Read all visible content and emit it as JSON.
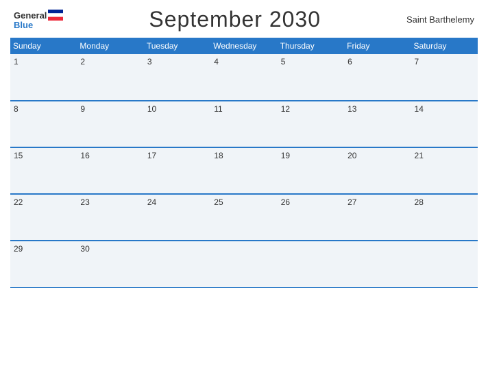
{
  "header": {
    "title": "September 2030",
    "country": "Saint Barthelemy",
    "logo_general": "General",
    "logo_blue": "Blue"
  },
  "weekdays": [
    "Sunday",
    "Monday",
    "Tuesday",
    "Wednesday",
    "Thursday",
    "Friday",
    "Saturday"
  ],
  "weeks": [
    [
      {
        "day": "1",
        "empty": false
      },
      {
        "day": "2",
        "empty": false
      },
      {
        "day": "3",
        "empty": false
      },
      {
        "day": "4",
        "empty": false
      },
      {
        "day": "5",
        "empty": false
      },
      {
        "day": "6",
        "empty": false
      },
      {
        "day": "7",
        "empty": false
      }
    ],
    [
      {
        "day": "8",
        "empty": false
      },
      {
        "day": "9",
        "empty": false
      },
      {
        "day": "10",
        "empty": false
      },
      {
        "day": "11",
        "empty": false
      },
      {
        "day": "12",
        "empty": false
      },
      {
        "day": "13",
        "empty": false
      },
      {
        "day": "14",
        "empty": false
      }
    ],
    [
      {
        "day": "15",
        "empty": false
      },
      {
        "day": "16",
        "empty": false
      },
      {
        "day": "17",
        "empty": false
      },
      {
        "day": "18",
        "empty": false
      },
      {
        "day": "19",
        "empty": false
      },
      {
        "day": "20",
        "empty": false
      },
      {
        "day": "21",
        "empty": false
      }
    ],
    [
      {
        "day": "22",
        "empty": false
      },
      {
        "day": "23",
        "empty": false
      },
      {
        "day": "24",
        "empty": false
      },
      {
        "day": "25",
        "empty": false
      },
      {
        "day": "26",
        "empty": false
      },
      {
        "day": "27",
        "empty": false
      },
      {
        "day": "28",
        "empty": false
      }
    ],
    [
      {
        "day": "29",
        "empty": false
      },
      {
        "day": "30",
        "empty": false
      },
      {
        "day": "",
        "empty": true
      },
      {
        "day": "",
        "empty": true
      },
      {
        "day": "",
        "empty": true
      },
      {
        "day": "",
        "empty": true
      },
      {
        "day": "",
        "empty": true
      }
    ]
  ]
}
